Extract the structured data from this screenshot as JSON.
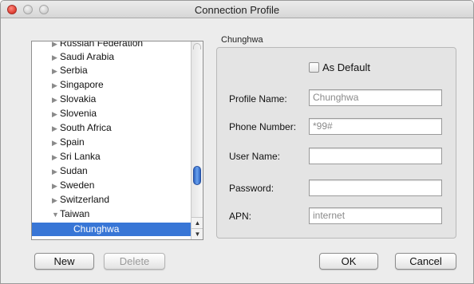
{
  "window": {
    "title": "Connection Profile"
  },
  "list": {
    "countries": [
      "Russian Federation",
      "Saudi Arabia",
      "Serbia",
      "Singapore",
      "Slovakia",
      "Slovenia",
      "South Africa",
      "Spain",
      "Sri Lanka",
      "Sudan",
      "Sweden",
      "Switzerland",
      "Taiwan"
    ],
    "expanded_country": "Taiwan",
    "selected_child": "Chunghwa",
    "collapsed_glyph": "▶",
    "expanded_glyph": "▼",
    "scroll_up_glyph": "▲",
    "scroll_down_glyph": "▼"
  },
  "profile": {
    "group_title": "Chunghwa",
    "as_default_label": "As Default",
    "as_default_checked": false,
    "fields": [
      {
        "label": "Profile Name:",
        "value": "Chunghwa"
      },
      {
        "label": "Phone Number:",
        "value": "*99#"
      },
      {
        "label": "User Name:",
        "value": ""
      },
      {
        "label": "Password:",
        "value": ""
      },
      {
        "label": "APN:",
        "value": "internet"
      }
    ]
  },
  "buttons": {
    "new": "New",
    "delete": "Delete",
    "ok": "OK",
    "cancel": "Cancel",
    "delete_enabled": false
  },
  "colors": {
    "selection": "#3876d6",
    "window_bg": "#ececec",
    "close_button": "#dd3b2f"
  }
}
